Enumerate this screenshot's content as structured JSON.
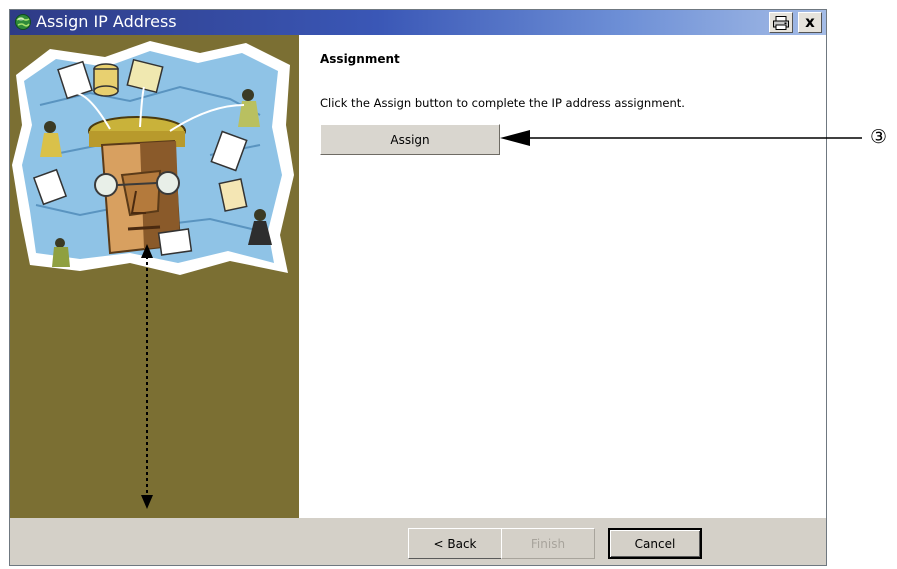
{
  "window": {
    "title": "Assign IP Address",
    "icon": "globe-network-icon",
    "print_icon": "print-icon",
    "close_label": "x"
  },
  "main": {
    "heading": "Assignment",
    "instruction": "Click the Assign button to complete the IP address assignment.",
    "assign_label": "Assign"
  },
  "footer": {
    "back_label": "< Back",
    "finish_label": "Finish",
    "cancel_label": "Cancel"
  },
  "annotation": {
    "callout_label": "③"
  },
  "colors": {
    "title_bar_start": "#2e3b86",
    "title_bar_end": "#a4bce6",
    "left_panel": "#7b6f33",
    "dialog_face": "#d4d0c8"
  }
}
